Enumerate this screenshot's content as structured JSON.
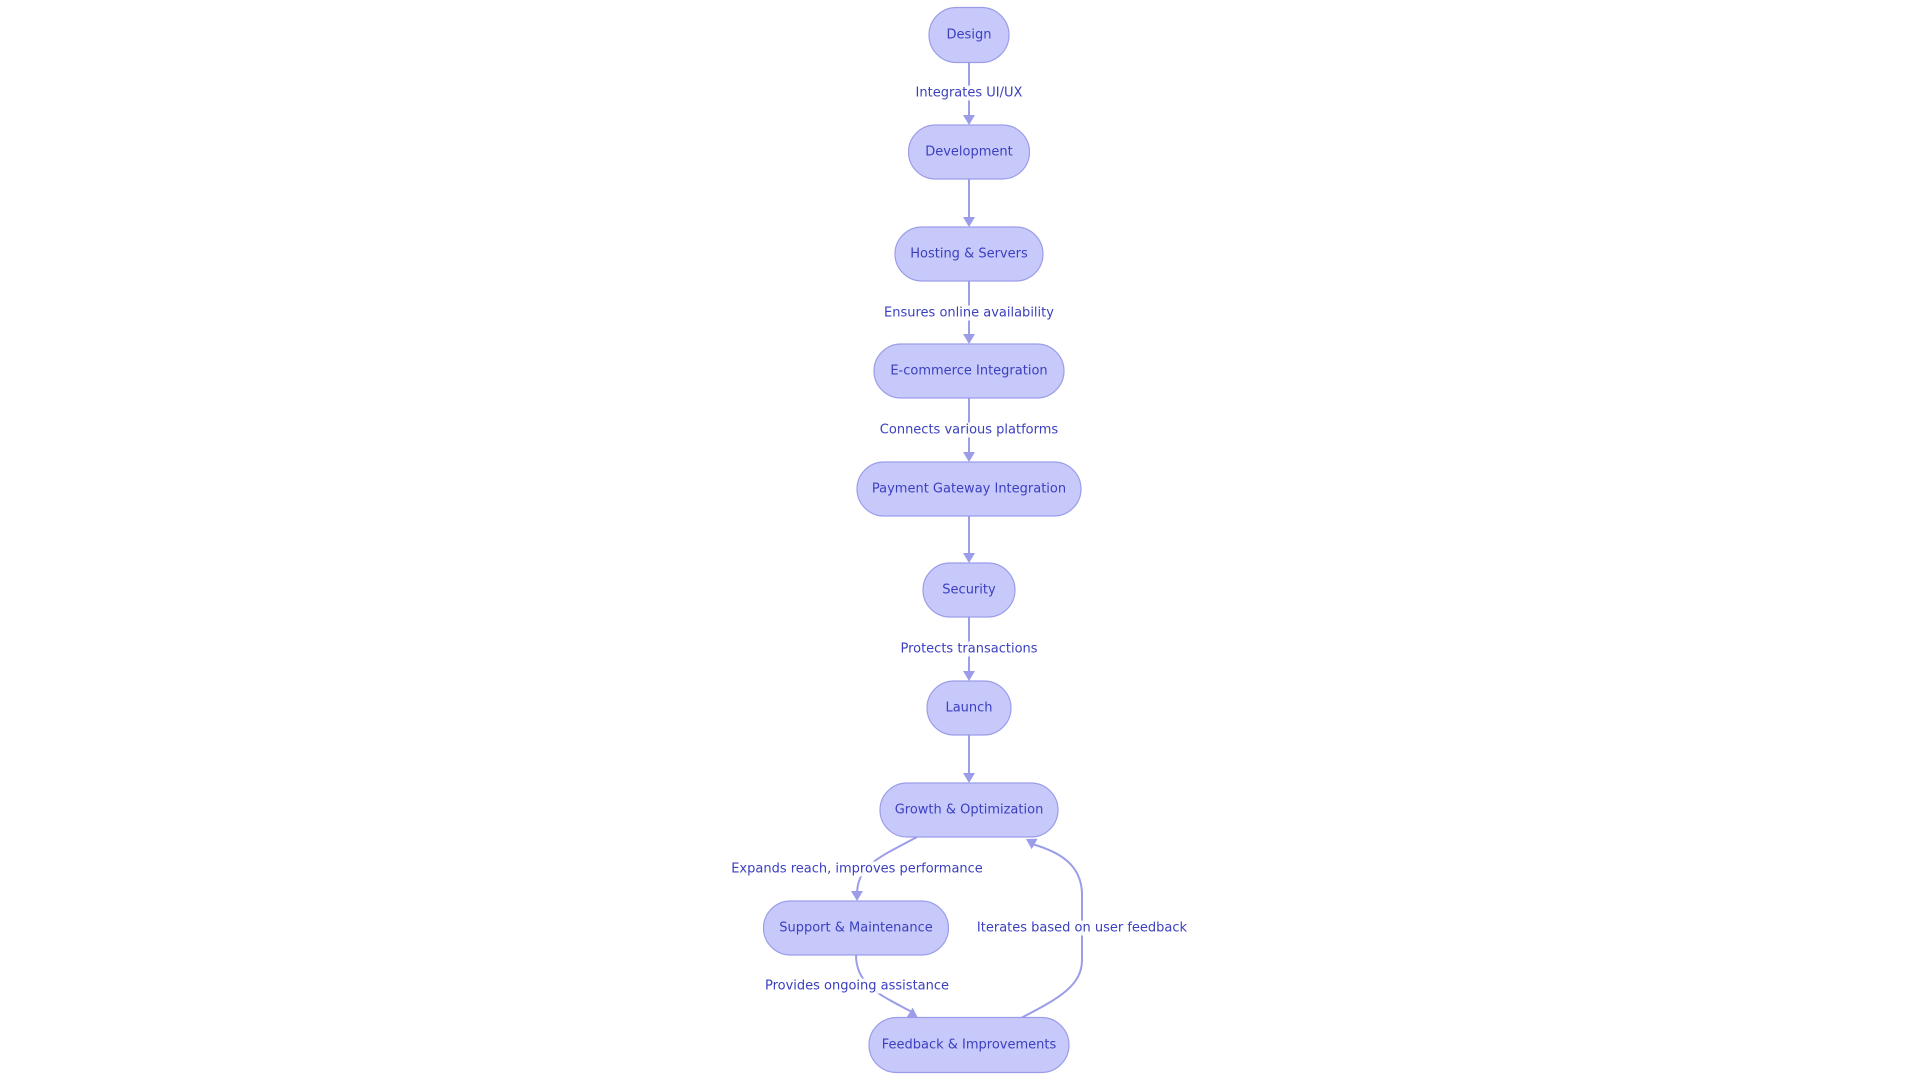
{
  "diagram": {
    "type": "flowchart",
    "direction": "top-down",
    "colors": {
      "node_fill": "#c8c9fb",
      "node_stroke": "#9b9de9",
      "text": "#3a3fbf",
      "edge": "#9b9de9"
    },
    "nodes": [
      {
        "id": "design",
        "label": "Design"
      },
      {
        "id": "development",
        "label": "Development"
      },
      {
        "id": "hosting",
        "label": "Hosting & Servers"
      },
      {
        "id": "ecommerce",
        "label": "E-commerce Integration"
      },
      {
        "id": "payment",
        "label": "Payment Gateway Integration"
      },
      {
        "id": "security",
        "label": "Security"
      },
      {
        "id": "launch",
        "label": "Launch"
      },
      {
        "id": "growth",
        "label": "Growth & Optimization"
      },
      {
        "id": "support",
        "label": "Support & Maintenance"
      },
      {
        "id": "feedback",
        "label": "Feedback & Improvements"
      }
    ],
    "edges": [
      {
        "from": "design",
        "to": "development",
        "label": "Integrates UI/UX"
      },
      {
        "from": "development",
        "to": "hosting",
        "label": ""
      },
      {
        "from": "hosting",
        "to": "ecommerce",
        "label": "Ensures online availability"
      },
      {
        "from": "ecommerce",
        "to": "payment",
        "label": "Connects various platforms"
      },
      {
        "from": "payment",
        "to": "security",
        "label": ""
      },
      {
        "from": "security",
        "to": "launch",
        "label": "Protects transactions"
      },
      {
        "from": "launch",
        "to": "growth",
        "label": ""
      },
      {
        "from": "growth",
        "to": "support",
        "label": "Expands reach, improves performance"
      },
      {
        "from": "support",
        "to": "feedback",
        "label": "Provides ongoing assistance"
      },
      {
        "from": "feedback",
        "to": "growth",
        "label": "Iterates based on user feedback"
      }
    ]
  }
}
